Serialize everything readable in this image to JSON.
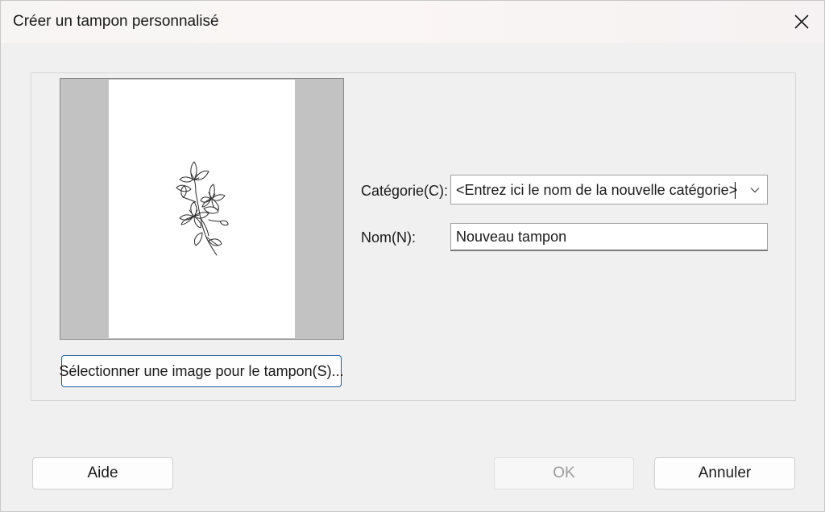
{
  "window": {
    "title": "Créer un tampon personnalisé"
  },
  "icons": {
    "close": "close-icon",
    "dropdown": "chevron-down-icon",
    "stamp": "flower-drawing"
  },
  "preview": {
    "select_button_label": "Sélectionner une image pour le tampon(S)..."
  },
  "form": {
    "category_label": "Catégorie(C):",
    "category_value": "<Entrez ici le nom de la nouvelle catégorie>",
    "name_label": "Nom(N):",
    "name_value": "Nouveau tampon"
  },
  "buttons": {
    "help": "Aide",
    "ok": "OK",
    "cancel": "Annuler"
  }
}
